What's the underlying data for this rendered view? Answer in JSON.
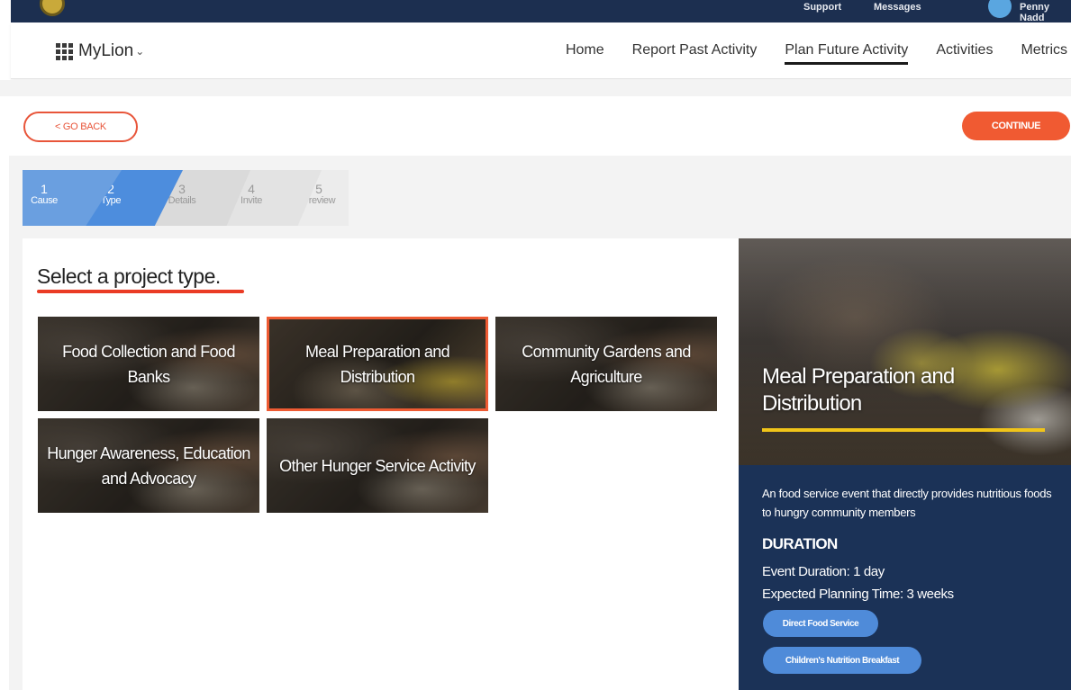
{
  "header": {
    "top_links": [
      "Support",
      "Messages"
    ],
    "user_name": "Penny Nadd"
  },
  "nav": {
    "brand": "MyLion",
    "links": [
      "Home",
      "Report Past Activity",
      "Plan Future Activity",
      "Activities",
      "Metrics"
    ],
    "active": "Plan Future Activity"
  },
  "toolbar": {
    "back_label": "< GO BACK",
    "continue_label": "CONTINUE"
  },
  "stepper": {
    "steps": [
      {
        "num": "1",
        "label": "Cause"
      },
      {
        "num": "2",
        "label": "Type"
      },
      {
        "num": "3",
        "label": "Details"
      },
      {
        "num": "4",
        "label": "Invite"
      },
      {
        "num": "5",
        "label": "Preview"
      }
    ],
    "current_step": 2
  },
  "main": {
    "heading": "Select a project type.",
    "tiles": [
      {
        "title": "Food Collection and Food Banks"
      },
      {
        "title": "Meal Preparation and Distribution"
      },
      {
        "title": "Community Gardens and Agriculture"
      },
      {
        "title": "Hunger Awareness, Education and Advocacy"
      },
      {
        "title": "Other Hunger Service Activity"
      }
    ],
    "selected": "Meal Preparation and Distribution"
  },
  "detail": {
    "title": "Meal Preparation and Distribution",
    "description": "An food service event that directly provides nutritious foods to hungry community members",
    "duration_heading": "DURATION",
    "event_duration": "Event Duration: 1 day",
    "planning_time": "Expected Planning Time: 3 weeks",
    "tags": [
      "Direct Food Service",
      "Children's Nutrition Breakfast"
    ]
  },
  "colors": {
    "accent": "#f05a32",
    "navy": "#1b3257",
    "step_active": "#4d8ddd",
    "highlight_bar": "#f0c419"
  }
}
